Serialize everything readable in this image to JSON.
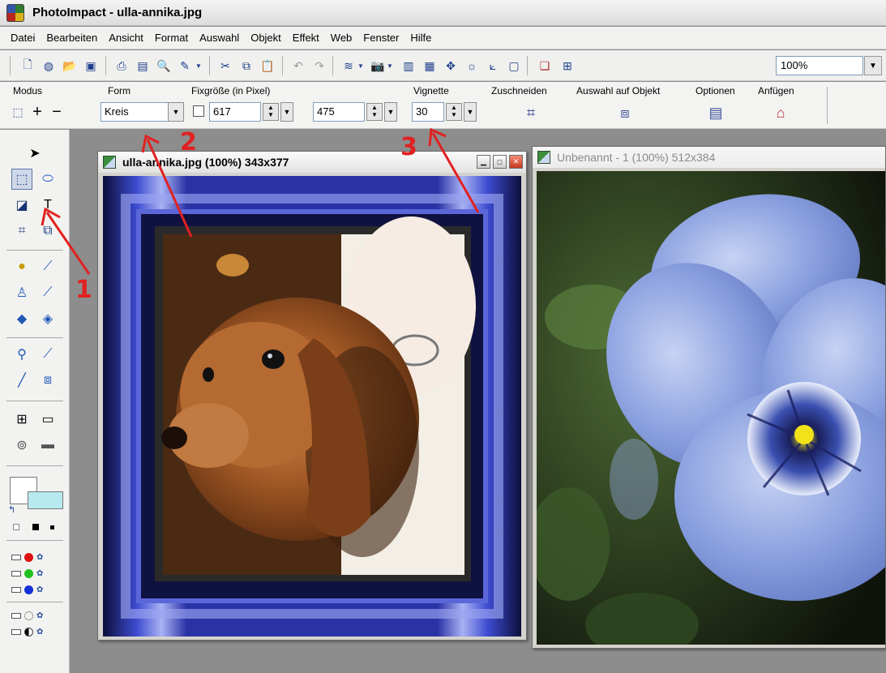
{
  "app": {
    "title": "PhotoImpact - ulla-annika.jpg"
  },
  "menu": [
    "Datei",
    "Bearbeiten",
    "Ansicht",
    "Format",
    "Auswahl",
    "Objekt",
    "Effekt",
    "Web",
    "Fenster",
    "Hilfe"
  ],
  "toolbar": {
    "zoom": "100%"
  },
  "attributes": {
    "modus_label": "Modus",
    "form_label": "Form",
    "form_value": "Kreis",
    "fixsize_label": "Fixgröße (in Pixel)",
    "width_value": "617",
    "height_value": "475",
    "vignette_label": "Vignette",
    "vignette_value": "30",
    "crop_label": "Zuschneiden",
    "selection_label": "Auswahl auf Objekt",
    "options_label": "Optionen",
    "append_label": "Anfügen"
  },
  "doc1": {
    "title": "ulla-annika.jpg (100%) 343x377"
  },
  "doc2": {
    "title": "Unbenannt - 1 (100%) 512x384"
  },
  "annotations": {
    "a1": "1",
    "a2": "2",
    "a3": "3"
  },
  "colors": {
    "annotation": "#e12121",
    "frame_blue": "#2e3ab8",
    "petal": "#8fa5e0"
  }
}
